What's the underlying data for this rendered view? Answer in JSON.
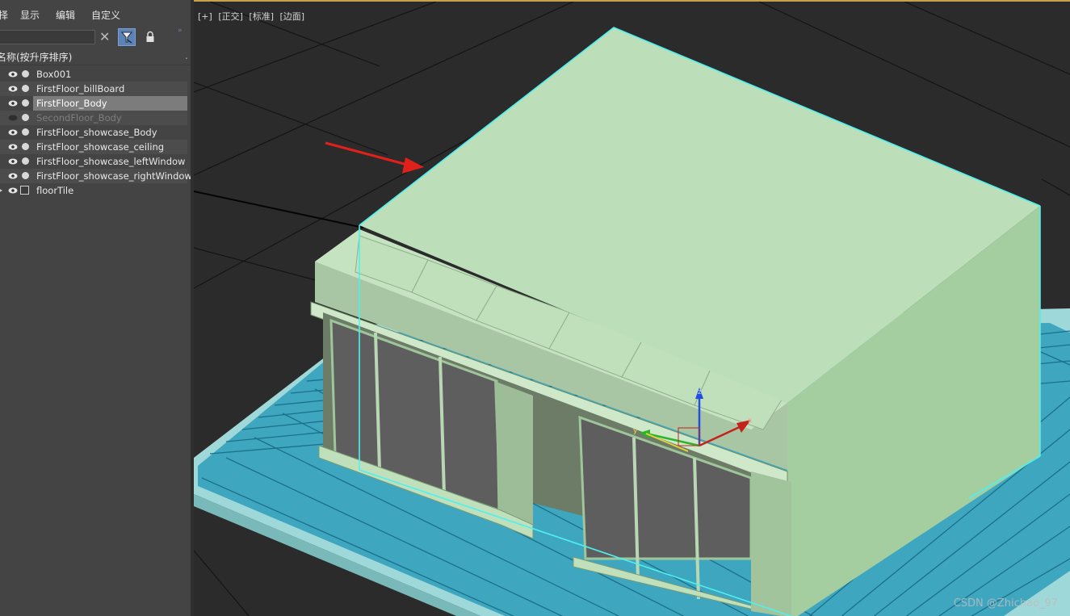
{
  "menu": {
    "items": [
      "择",
      "显示",
      "编辑",
      "自定义"
    ]
  },
  "toolbar": {
    "search_value": "",
    "clear_icon": "close-icon",
    "filter_icon": "filter-icon",
    "lock_icon": "lock-icon",
    "more": "»"
  },
  "explorer": {
    "column_header": "名称(按升序排序)",
    "header_tail": "."
  },
  "objects": [
    {
      "name": "Box001",
      "visible": true
    },
    {
      "name": "FirstFloor_billBoard",
      "visible": true
    },
    {
      "name": "FirstFloor_Body",
      "visible": true,
      "selected": true
    },
    {
      "name": "SecondFloor_Body",
      "visible": false
    },
    {
      "name": "FirstFloor_showcase_Body",
      "visible": true
    },
    {
      "name": "FirstFloor_showcase_ceiling",
      "visible": true
    },
    {
      "name": "FirstFloor_showcase_leftWindow",
      "visible": true
    },
    {
      "name": "FirstFloor_showcase_rightWindow",
      "visible": true
    },
    {
      "name": "floorTile",
      "visible": true,
      "group": true
    }
  ],
  "viewport": {
    "labels": [
      "[+]",
      "[正交]",
      "[标准]",
      "[边面]"
    ],
    "gizmo": {
      "x": "x",
      "y": "y",
      "z": "z"
    }
  },
  "colors": {
    "selection_outline": "#4ff0f0",
    "building": "#b9ddb7",
    "tile": "#3fa6c0",
    "arrow": "#e0201a",
    "viewport_bg": "#2b2b2b"
  },
  "watermark": "CSDN @Zhichao_97"
}
